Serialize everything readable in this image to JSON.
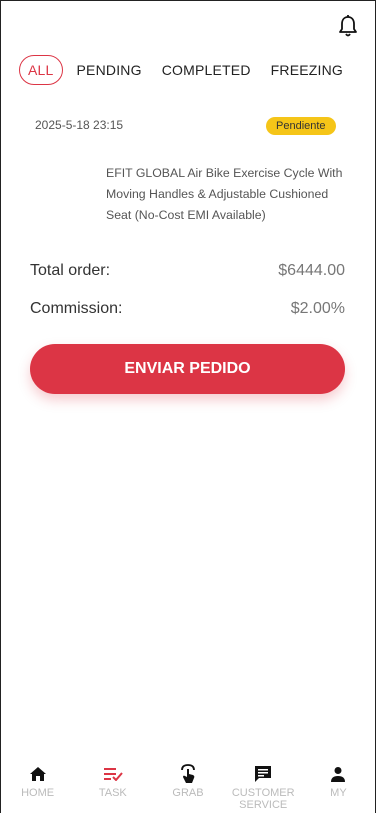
{
  "header": {
    "notification_icon": "bell-icon"
  },
  "tabs": [
    {
      "label": "ALL",
      "active": true
    },
    {
      "label": "PENDING",
      "active": false
    },
    {
      "label": "COMPLETED",
      "active": false
    },
    {
      "label": "FREEZING",
      "active": false
    }
  ],
  "order": {
    "date": "2025-5-18 23:15",
    "status": "Pendiente",
    "status_color": "#f5c518",
    "product_title": "EFIT GLOBAL Air Bike Exercise Cycle With Moving Handles & Adjustable Cushioned Seat (No-Cost EMI Available)",
    "total_label": "Total order:",
    "total_value": "$6444.00",
    "commission_label": "Commission:",
    "commission_value": "$2.00%",
    "submit_label": "ENVIAR PEDIDO"
  },
  "colors": {
    "accent": "#dc3545"
  },
  "bottom_nav": [
    {
      "label": "HOME",
      "icon": "home-icon",
      "active": false
    },
    {
      "label": "TASK",
      "icon": "task-list-icon",
      "active": true
    },
    {
      "label": "GRAB",
      "icon": "tap-icon",
      "active": false
    },
    {
      "label": "CUSTOMER SERVICE",
      "icon": "chat-icon",
      "active": false
    },
    {
      "label": "MY",
      "icon": "person-icon",
      "active": false
    }
  ]
}
